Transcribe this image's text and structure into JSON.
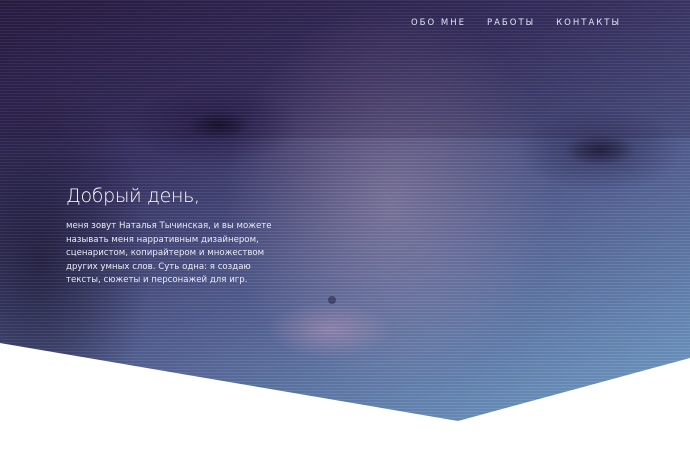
{
  "nav": {
    "items": [
      {
        "label": "ОБО МНЕ"
      },
      {
        "label": "РАБОТЫ"
      },
      {
        "label": "КОНТАКТЫ"
      }
    ]
  },
  "hero": {
    "title": "Добрый день,",
    "text": "меня зовут Наталья Тычинская, и вы можете называть меня нарративным дизайнером, сценаристом, копирайтером и множеством других умных слов. Суть одна: я создаю тексты, сюжеты и персонажей для игр."
  },
  "colors": {
    "gradient_start": "#2b1e45",
    "gradient_end": "#79aed6",
    "background": "#ffffff"
  }
}
